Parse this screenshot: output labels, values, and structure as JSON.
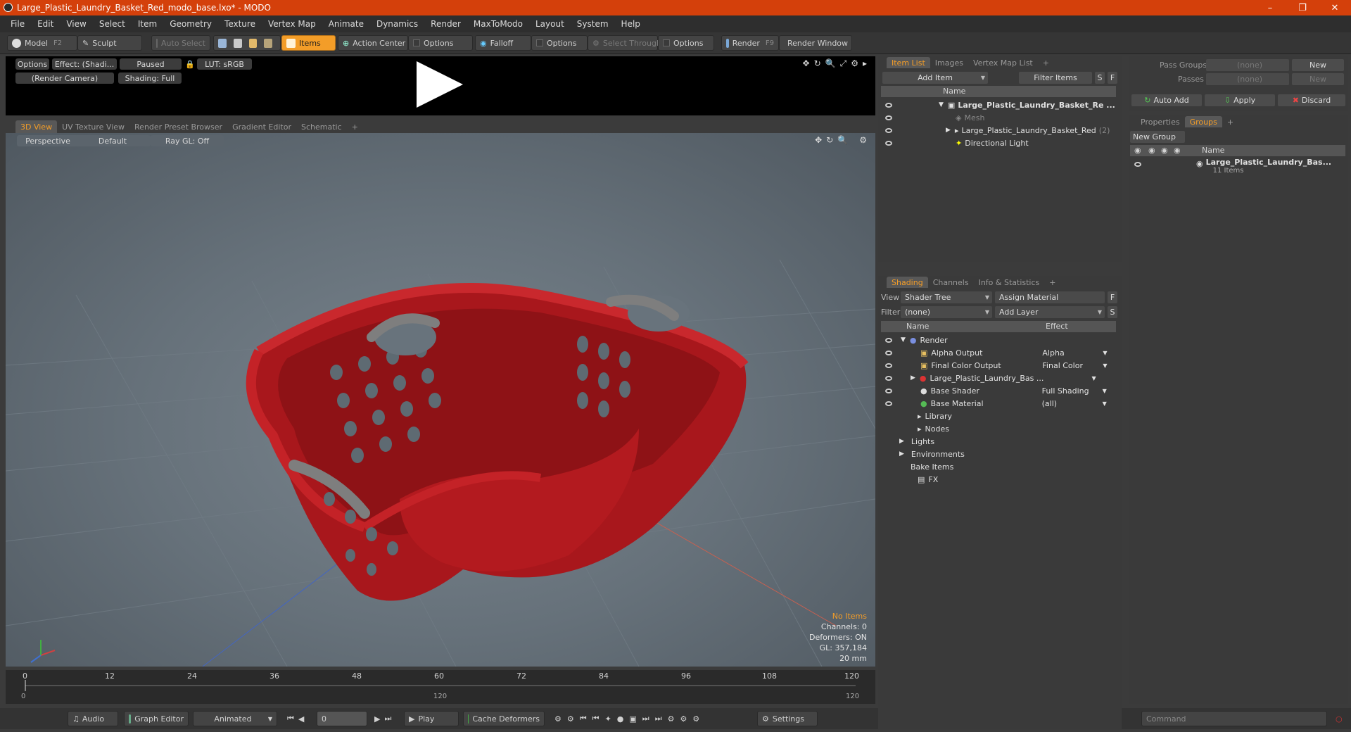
{
  "window": {
    "title": "Large_Plastic_Laundry_Basket_Red_modo_base.lxo* - MODO"
  },
  "menu": [
    "File",
    "Edit",
    "View",
    "Select",
    "Item",
    "Geometry",
    "Texture",
    "Vertex Map",
    "Animate",
    "Dynamics",
    "Render",
    "MaxToModo",
    "Layout",
    "System",
    "Help"
  ],
  "toolbar": {
    "model": "Model",
    "model_key": "F2",
    "sculpt": "Sculpt",
    "auto_select": "Auto Select",
    "items": "Items",
    "action_center": "Action Center",
    "options1": "Options",
    "falloff": "Falloff",
    "options2": "Options",
    "select_through": "Select Through",
    "options3": "Options",
    "render": "Render",
    "render_key": "F9",
    "render_window": "Render Window"
  },
  "preview": {
    "options": "Options",
    "effect": "Effect: (Shadi...",
    "paused": "Paused",
    "lut": "LUT: sRGB",
    "camera": "(Render Camera)",
    "shading": "Shading: Full"
  },
  "viewport_tabs": [
    "3D View",
    "UV Texture View",
    "Render Preset Browser",
    "Gradient Editor",
    "Schematic"
  ],
  "viewport": {
    "perspective": "Perspective",
    "default": "Default",
    "raygl": "Ray GL: Off",
    "info": {
      "no_items": "No Items",
      "channels": "Channels: 0",
      "deformers": "Deformers: ON",
      "gl": "GL: 357,184",
      "mm": "20 mm"
    }
  },
  "timeline": {
    "ticks": [
      "0",
      "12",
      "24",
      "36",
      "48",
      "60",
      "72",
      "84",
      "96",
      "108",
      "120"
    ],
    "bottom_left": "0",
    "bottom_mid": "120",
    "bottom_right": "120"
  },
  "bottom": {
    "audio": "Audio",
    "graph_editor": "Graph Editor",
    "animated": "Animated",
    "frame": "0",
    "play": "Play",
    "cache_deformers": "Cache Deformers",
    "settings": "Settings",
    "command": "Command"
  },
  "item_list": {
    "tabs": [
      "Item List",
      "Images",
      "Vertex Map List"
    ],
    "add_item": "Add Item",
    "filter_items": "Filter Items",
    "s": "S",
    "f": "F",
    "name_col": "Name",
    "rows": [
      {
        "label": "Large_Plastic_Laundry_Basket_Re ...",
        "extra": ""
      },
      {
        "label": "Mesh",
        "extra": ""
      },
      {
        "label": "Large_Plastic_Laundry_Basket_Red",
        "extra": "(2)"
      },
      {
        "label": "Directional Light",
        "extra": ""
      }
    ]
  },
  "shading": {
    "tabs": [
      "Shading",
      "Channels",
      "Info & Statistics"
    ],
    "view_label": "View",
    "view_value": "Shader Tree",
    "assign_material": "Assign Material",
    "f": "F",
    "filter_label": "Filter",
    "filter_value": "(none)",
    "add_layer": "Add Layer",
    "s": "S",
    "name_col": "Name",
    "effect_col": "Effect",
    "rows": [
      {
        "label": "Render",
        "effect": ""
      },
      {
        "label": "Alpha Output",
        "effect": "Alpha"
      },
      {
        "label": "Final Color Output",
        "effect": "Final Color"
      },
      {
        "label": "Large_Plastic_Laundry_Bas ...",
        "effect": ""
      },
      {
        "label": "Base Shader",
        "effect": "Full Shading"
      },
      {
        "label": "Base Material",
        "effect": "(all)"
      },
      {
        "label": "Library",
        "effect": ""
      },
      {
        "label": "Nodes",
        "effect": ""
      },
      {
        "label": "Lights",
        "effect": ""
      },
      {
        "label": "Environments",
        "effect": ""
      },
      {
        "label": "Bake Items",
        "effect": ""
      },
      {
        "label": "FX",
        "effect": ""
      }
    ]
  },
  "passes": {
    "pass_groups": "Pass Groups",
    "passes": "Passes",
    "none1": "(none)",
    "none2": "(none)",
    "new1": "New",
    "new2": "New",
    "auto_add": "Auto Add",
    "apply": "Apply",
    "discard": "Discard"
  },
  "groups": {
    "tabs": [
      "Properties",
      "Groups"
    ],
    "new_group": "New Group",
    "name_col": "Name",
    "item": "Large_Plastic_Laundry_Bas...",
    "count": "11 Items"
  },
  "colors": {
    "accent": "#f39d28",
    "title": "#d4400b",
    "basket": "#b31a1f"
  }
}
